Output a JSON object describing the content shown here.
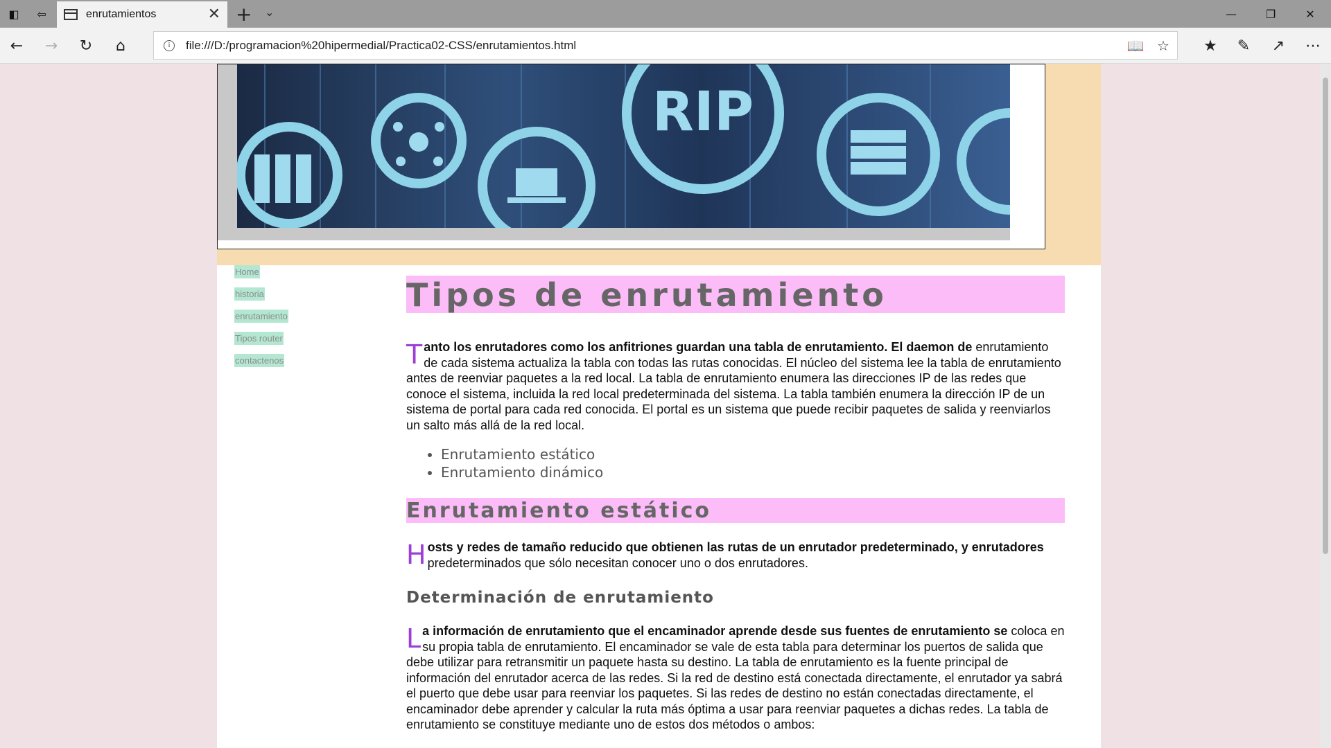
{
  "browser": {
    "tab_title": "enrutamientos",
    "url": "file:///D:/programacion%20hipermedial/Practica02-CSS/enrutamientos.html"
  },
  "banner": {
    "logo_text": "RIP"
  },
  "nav": {
    "items": [
      {
        "label": "Home"
      },
      {
        "label": "historia"
      },
      {
        "label": "enrutamiento"
      },
      {
        "label": "Tipos router"
      },
      {
        "label": "contactenos"
      }
    ]
  },
  "content": {
    "title": "Tipos de enrutamiento",
    "intro": {
      "drop": "T",
      "lead": "anto los enrutadores como los anfitriones guardan una tabla de enrutamiento. El daemon de",
      "body": "enrutamiento de cada sistema actualiza la tabla con todas las rutas conocidas. El núcleo del sistema lee la tabla de enrutamiento antes de reenviar paquetes a la red local. La tabla de enrutamiento enumera las direcciones IP de las redes que conoce el sistema, incluida la red local predeterminada del sistema. La tabla también enumera la dirección IP de un sistema de portal para cada red conocida. El portal es un sistema que puede recibir paquetes de salida y reenviarlos un salto más allá de la red local."
    },
    "list": [
      "Enrutamiento estático",
      "Enrutamiento dinámico"
    ],
    "section1": {
      "heading": "Enrutamiento estático",
      "drop": "H",
      "lead": "osts y redes de tamaño reducido que obtienen las rutas de un enrutador predeterminado, y enrutadores",
      "body": "predeterminados que sólo necesitan conocer uno o dos enrutadores."
    },
    "section2": {
      "heading": "Determinación de enrutamiento",
      "drop": "L",
      "lead": "a información de enrutamiento que el encaminador aprende desde sus fuentes de enrutamiento se",
      "body": "coloca en su propia tabla de enrutamiento. El encaminador se vale de esta tabla para determinar los puertos de salida que debe utilizar para retransmitir un paquete hasta su destino. La tabla de enrutamiento es la fuente principal de información del enrutador acerca de las redes. Si la red de destino está conectada directamente, el enrutador ya sabrá el puerto que debe usar para reenviar los paquetes. Si las redes de destino no están conectadas directamente, el encaminador debe aprender y calcular la ruta más óptima a usar para reenviar paquetes a dichas redes. La tabla de enrutamiento se constituye mediante uno de estos dos métodos o ambos:"
    }
  }
}
